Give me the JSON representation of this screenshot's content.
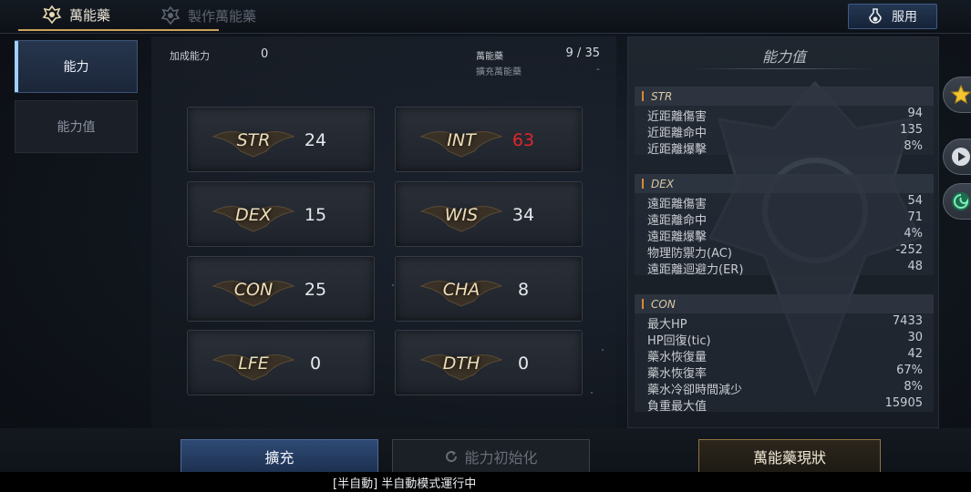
{
  "tabs": {
    "active_label": "萬能藥",
    "inactive_label": "製作萬能藥"
  },
  "use_button": {
    "label": "服用",
    "icon": "potion-icon"
  },
  "sidenav": [
    {
      "label": "能力",
      "selected": true
    },
    {
      "label": "能力值",
      "selected": false
    }
  ],
  "info": {
    "bonus_label": "加成能力",
    "bonus_value": "0",
    "elixir_label": "萬能藥",
    "elixir_value": "9 / 35",
    "expand_label": "擴充萬能藥",
    "expand_value": "-"
  },
  "stats": [
    {
      "name": "STR",
      "value": "24",
      "highlight": false
    },
    {
      "name": "INT",
      "value": "63",
      "highlight": true
    },
    {
      "name": "DEX",
      "value": "15",
      "highlight": false
    },
    {
      "name": "WIS",
      "value": "34",
      "highlight": false
    },
    {
      "name": "CON",
      "value": "25",
      "highlight": false
    },
    {
      "name": "CHA",
      "value": "8",
      "highlight": false
    },
    {
      "name": "LFE",
      "value": "0",
      "highlight": false
    },
    {
      "name": "DTH",
      "value": "0",
      "highlight": false
    }
  ],
  "ability_panel": {
    "title": "能力值",
    "sections": [
      {
        "header": "STR",
        "rows": [
          {
            "label": "近距離傷害",
            "value": "94"
          },
          {
            "label": "近距離命中",
            "value": "135"
          },
          {
            "label": "近距離爆擊",
            "value": "8%"
          }
        ]
      },
      {
        "header": "DEX",
        "rows": [
          {
            "label": "遠距離傷害",
            "value": "54"
          },
          {
            "label": "遠距離命中",
            "value": "71"
          },
          {
            "label": "遠距離爆擊",
            "value": "4%"
          },
          {
            "label": "物理防禦力(AC)",
            "value": "-252"
          },
          {
            "label": "遠距離迴避力(ER)",
            "value": "48"
          }
        ]
      },
      {
        "header": "CON",
        "rows": [
          {
            "label": "最大HP",
            "value": "7433"
          },
          {
            "label": "HP回復(tic)",
            "value": "30"
          },
          {
            "label": "藥水恢復量",
            "value": "42"
          },
          {
            "label": "藥水恢復率",
            "value": "67%"
          },
          {
            "label": "藥水冷卻時間減少",
            "value": "8%"
          },
          {
            "label": "負重最大值",
            "value": "15905"
          }
        ]
      }
    ]
  },
  "buttons": {
    "expand": "擴充",
    "reset": "能力初始化",
    "status": "萬能藥現狀"
  },
  "status_bar": "[半自動] 半自動模式運行中",
  "colors": {
    "accent_gold": "#c9a45a",
    "highlight_red": "#e0262a",
    "button_blue": "#2e4a75"
  }
}
